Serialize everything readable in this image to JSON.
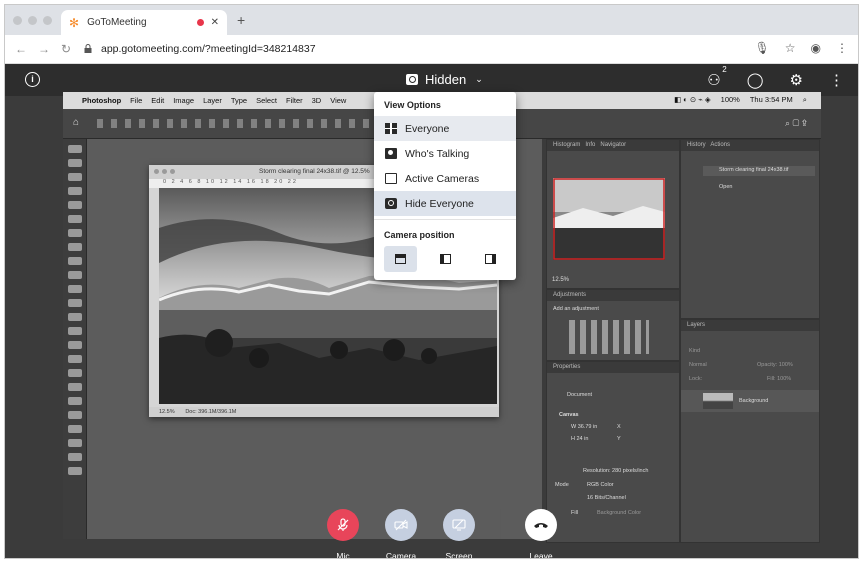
{
  "browser": {
    "tab_title": "GoToMeeting",
    "tab_favicon": "gotomeeting-logo-icon",
    "url": "app.gotomeeting.com/?meetingId=348214837"
  },
  "header": {
    "view_label": "Hidden",
    "participants_count": "2"
  },
  "shared_screen": {
    "menubar": [
      "Photoshop",
      "File",
      "Edit",
      "Image",
      "Layer",
      "Type",
      "Select",
      "Filter",
      "3D",
      "View"
    ],
    "battery": "100%",
    "clock": "Thu 3:54 PM",
    "document_title": "Storm clearing final 24x38.tif @ 12.5%",
    "ruler_marks": "0  2  4  6  8  10  12  14  16  18  20  22",
    "zoom": "12.5%",
    "doc_size": "Doc: 396.1M/396.1M",
    "panel_tabs_left": [
      "Histogram",
      "Info",
      "Navigator"
    ],
    "panel_tabs_right": [
      "History",
      "Actions"
    ],
    "history_item": "Storm clearing final 24x38.tif",
    "history_open": "Open",
    "navigator_zoom": "12.5%",
    "adjustments_title": "Adjustments",
    "adjustments_add": "Add an adjustment",
    "layers_title": "Layers",
    "layers_kind": "Kind",
    "layers_mode": "Normal",
    "layers_opacity": "Opacity: 100%",
    "layers_lock": "Lock:",
    "layers_fill": "Fill: 100%",
    "layer_name": "Background",
    "properties_title": "Properties",
    "properties_document": "Document",
    "canvas_label": "Canvas",
    "canvas_w": "W 36.79 in",
    "canvas_h": "H 24 in",
    "x_label": "X",
    "y_label": "Y",
    "resolution": "Resolution: 280 pixels/inch",
    "mode_label": "Mode",
    "mode_value": "RGB Color",
    "depth_value": "16 Bits/Channel",
    "fill_label": "Fill",
    "fill_value": "Background Color"
  },
  "view_options": {
    "title": "View Options",
    "items": [
      {
        "label": "Everyone",
        "icon": "grid-icon"
      },
      {
        "label": "Who's Talking",
        "icon": "speaker-icon"
      },
      {
        "label": "Active Cameras",
        "icon": "camera-frame-icon"
      },
      {
        "label": "Hide Everyone",
        "icon": "hidden-icon"
      }
    ],
    "camera_position_title": "Camera position"
  },
  "controls": {
    "mic": "Mic",
    "camera": "Camera",
    "screen": "Screen",
    "leave": "Leave"
  },
  "colors": {
    "mic_muted": "#e8455a",
    "disabled_buttons": "#c5cfe0",
    "header_bg": "#2d2d2d"
  }
}
